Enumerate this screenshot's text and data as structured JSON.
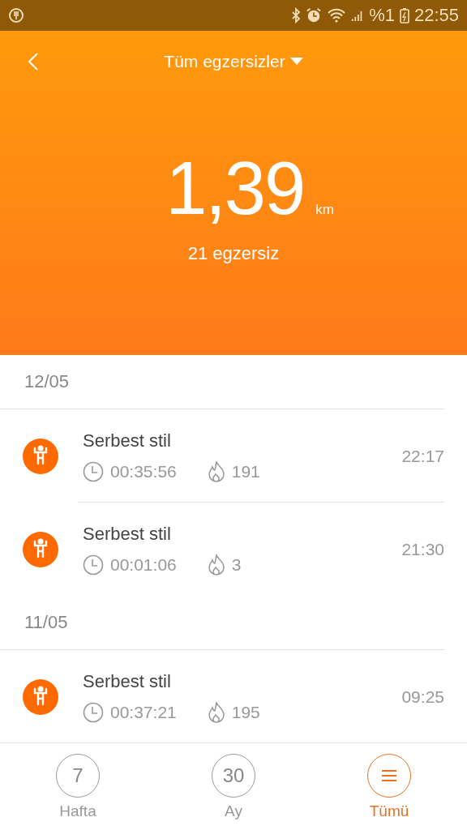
{
  "status_bar": {
    "battery": "%1",
    "time": "22:55"
  },
  "header": {
    "title": "Tüm egzersizler",
    "distance": "1,39",
    "unit": "km",
    "count": "21 egzersiz"
  },
  "groups": [
    {
      "date": "12/05",
      "sessions": [
        {
          "name": "Serbest stil",
          "duration": "00:35:56",
          "calories": "191",
          "time": "22:17"
        },
        {
          "name": "Serbest stil",
          "duration": "00:01:06",
          "calories": "3",
          "time": "21:30"
        }
      ]
    },
    {
      "date": "11/05",
      "sessions": [
        {
          "name": "Serbest stil",
          "duration": "00:37:21",
          "calories": "195",
          "time": "09:25"
        }
      ]
    }
  ],
  "tabs": [
    {
      "kind": "number",
      "icon_text": "7",
      "label": "Hafta",
      "selected": false
    },
    {
      "kind": "number",
      "icon_text": "30",
      "label": "Ay",
      "selected": false
    },
    {
      "kind": "menu",
      "label": "Tümü",
      "selected": true
    }
  ]
}
